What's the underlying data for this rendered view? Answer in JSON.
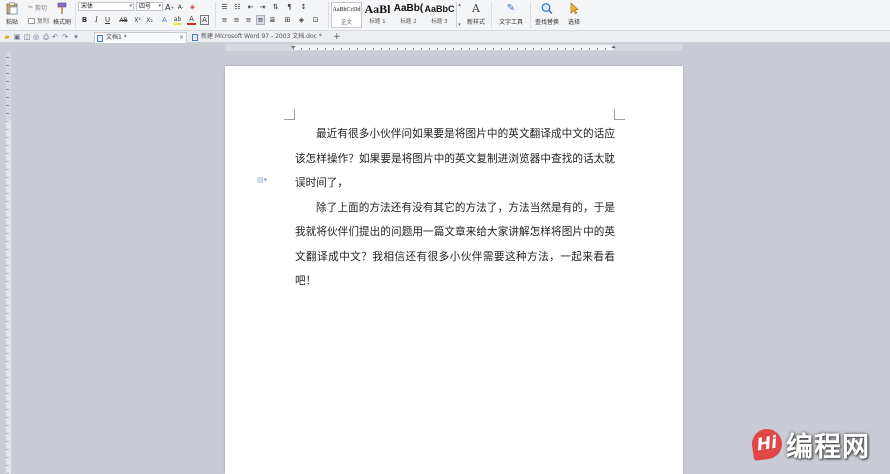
{
  "ribbon": {
    "paste_label": "粘贴",
    "cut_label": "剪切",
    "copy_label": "复制",
    "format_painter_label": "格式刷",
    "font_name": "宋体",
    "font_size": "四号",
    "grow_font": "A",
    "shrink_font": "A",
    "bold": "B",
    "italic": "I",
    "underline": "U",
    "strikethrough": "AB",
    "superscript": "X²",
    "subscript": "X₂",
    "text_effect": "A",
    "highlight": "ab",
    "font_color": "A",
    "char_border": "A",
    "styles": [
      {
        "sample": "AaBbCcDd",
        "name": "正文"
      },
      {
        "sample": "AaBl",
        "name": "标题 1"
      },
      {
        "sample": "AaBb(",
        "name": "标题 2"
      },
      {
        "sample": "AaBbC",
        "name": "标题 3"
      }
    ],
    "new_style_label": "新样式",
    "text_tools_label": "文字工具",
    "find_replace_label": "查找替换",
    "select_label": "选择"
  },
  "tabs": [
    {
      "label": "文档1 *",
      "active": true
    },
    {
      "label": "新建 Microsoft Word 97 - 2003 文档.doc *",
      "active": false
    }
  ],
  "document": {
    "paragraphs": [
      "最近有很多小伙伴问如果要是将图片中的英文翻译成中文的话应该怎样操作？如果要是将图片中的英文复制进浏览器中查找的话太耽误时间了，",
      "除了上面的方法还有没有其它的方法了，方法当然是有的，于是我就将伙伴们提出的问题用一篇文章来给大家讲解怎样将图片中的英文翻译成中文？我相信还有很多小伙伴需要这种方法，一起来看看吧！"
    ]
  },
  "watermark": {
    "logo": "Hi",
    "text": "编程网"
  },
  "colors": {
    "accent": "#4e78b8",
    "watermark_logo": "#e04848",
    "workspace": "#c9ccd4"
  }
}
